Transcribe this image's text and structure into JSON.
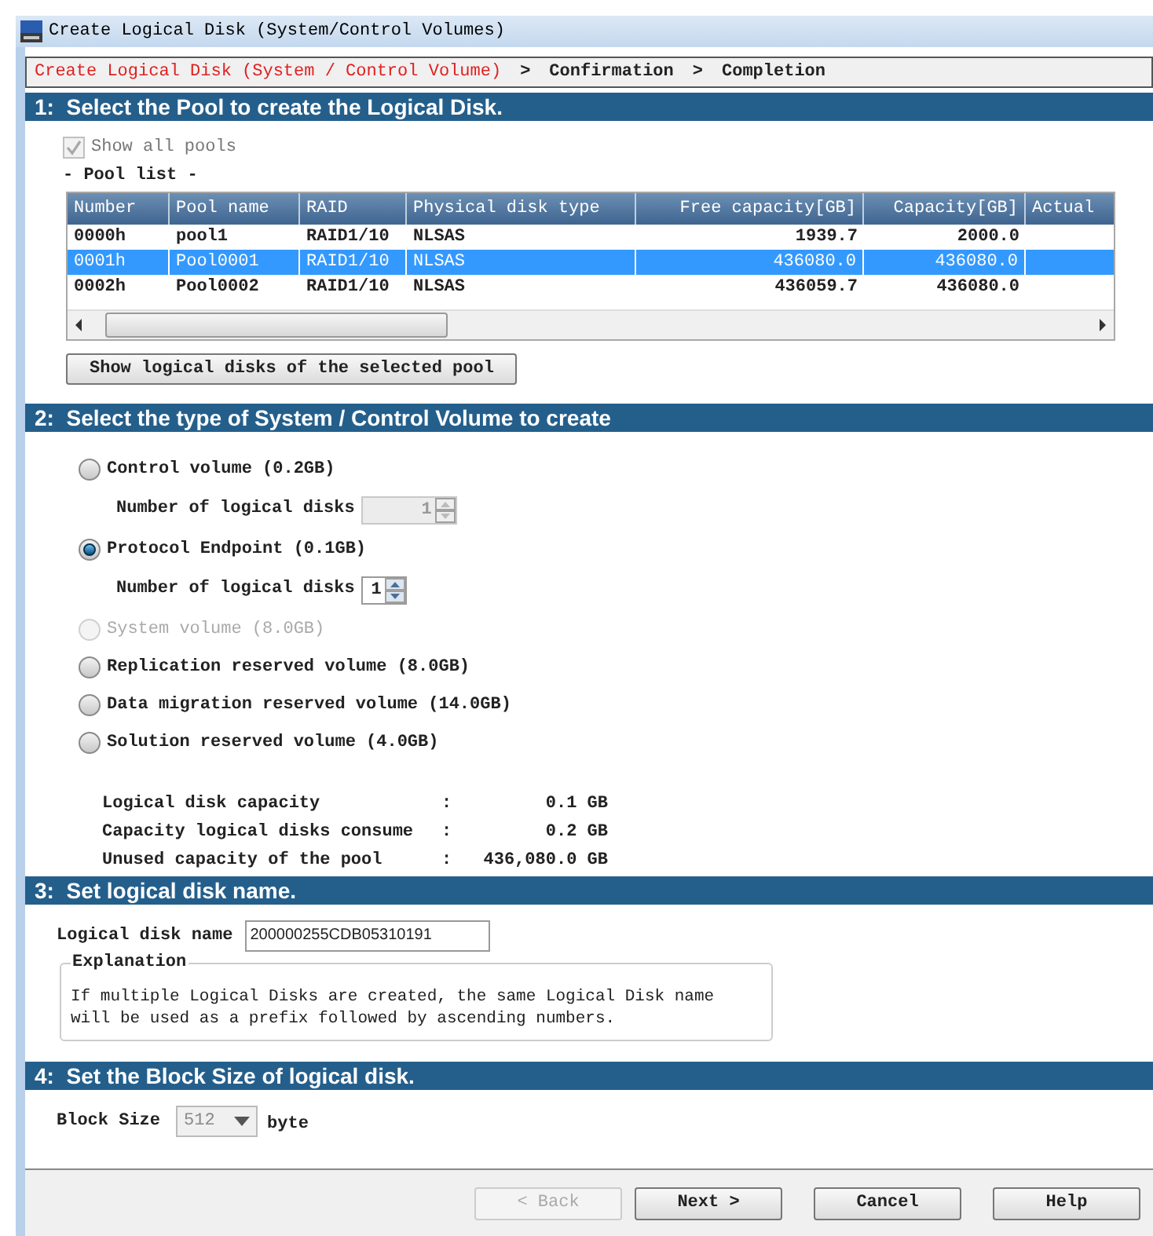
{
  "window": {
    "title": "Create Logical Disk (System/Control Volumes)"
  },
  "breadcrumb": {
    "separator": ">",
    "steps": [
      {
        "label": "Create Logical Disk (System / Control Volume)",
        "selected": true
      },
      {
        "label": "Confirmation",
        "selected": false
      },
      {
        "label": "Completion",
        "selected": false
      }
    ]
  },
  "section_1": {
    "header": "1:  Select the Pool to create the Logical Disk.",
    "show_all_pools": {
      "label": "Show all pools",
      "checked": true,
      "disabled": true
    },
    "pool_list_label": "- Pool list -",
    "table": {
      "columns": [
        "Number",
        "Pool name",
        "RAID",
        "Physical disk type",
        "Free capacity[GB]",
        "Capacity[GB]",
        "Actual"
      ],
      "rows": [
        {
          "cells": [
            "0000h",
            "pool1",
            "RAID1/10",
            "NLSAS",
            "1939.7",
            "2000.0"
          ],
          "selected": false
        },
        {
          "cells": [
            "0001h",
            "Pool0001",
            "RAID1/10",
            "NLSAS",
            "436080.0",
            "436080.0"
          ],
          "selected": true
        },
        {
          "cells": [
            "0002h",
            "Pool0002",
            "RAID1/10",
            "NLSAS",
            "436059.7",
            "436080.0"
          ],
          "selected": false
        }
      ]
    },
    "button": "Show logical disks of the selected pool"
  },
  "section_2": {
    "header": "2:  Select the type of System / Control Volume to create",
    "options": [
      {
        "label": "Control volume (0.2GB)",
        "selected": false,
        "disabled": false,
        "spinner": {
          "label": "Number of logical disks",
          "value": "1",
          "disabled": true
        }
      },
      {
        "label": "Protocol Endpoint (0.1GB)",
        "selected": true,
        "disabled": false,
        "spinner": {
          "label": "Number of logical disks",
          "value": "1",
          "disabled": false
        }
      },
      {
        "label": "System volume (8.0GB)",
        "selected": false,
        "disabled": true
      },
      {
        "label": "Replication reserved volume (8.0GB)",
        "selected": false,
        "disabled": false
      },
      {
        "label": "Data migration reserved volume (14.0GB)",
        "selected": false,
        "disabled": false
      },
      {
        "label": "Solution reserved volume (4.0GB)",
        "selected": false,
        "disabled": false
      }
    ],
    "summary": [
      {
        "label": "Logical disk capacity",
        "colon": ":",
        "value": "0.1 GB"
      },
      {
        "label": "Capacity logical disks consume",
        "colon": ":",
        "value": "0.2 GB"
      },
      {
        "label": "Unused capacity of the pool",
        "colon": ":",
        "value": "436,080.0 GB"
      }
    ]
  },
  "section_3": {
    "header": "3:  Set logical disk name.",
    "name_label": "Logical disk name",
    "name_value": "200000255CDB05310191",
    "explanation": {
      "legend": "Explanation",
      "text": "If multiple Logical Disks are created, the same Logical Disk name will be used as a prefix followed by ascending numbers."
    }
  },
  "section_4": {
    "header": "4:  Set the Block Size of logical disk.",
    "label": "Block Size",
    "value": "512",
    "disabled": true,
    "unit": "byte"
  },
  "buttons": [
    {
      "label": "< Back",
      "disabled": true
    },
    {
      "label": "Next >",
      "disabled": false
    },
    {
      "label": "Cancel",
      "disabled": false
    },
    {
      "label": "Help",
      "disabled": false
    }
  ]
}
